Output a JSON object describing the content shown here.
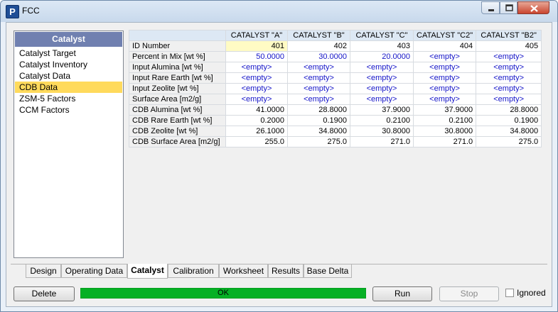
{
  "window": {
    "title": "FCC",
    "app_icon_letter": "P"
  },
  "sidebar": {
    "header": "Catalyst",
    "items": [
      {
        "label": "Catalyst Target",
        "selected": false
      },
      {
        "label": "Catalyst Inventory",
        "selected": false
      },
      {
        "label": "Catalyst Data",
        "selected": false
      },
      {
        "label": "CDB Data",
        "selected": true
      },
      {
        "label": "ZSM-5 Factors",
        "selected": false
      },
      {
        "label": "CCM Factors",
        "selected": false
      }
    ]
  },
  "grid": {
    "columns": [
      "CATALYST \"A\"",
      "CATALYST \"B\"",
      "CATALYST \"C\"",
      "CATALYST \"C2\"",
      "CATALYST \"B2\""
    ],
    "rows": [
      {
        "label": "ID Number",
        "style": "black",
        "values": [
          "401",
          "402",
          "403",
          "404",
          "405"
        ]
      },
      {
        "label": "Percent in Mix [wt %]",
        "style": "blue",
        "values": [
          "50.0000",
          "30.0000",
          "20.0000",
          "<empty>",
          "<empty>"
        ]
      },
      {
        "label": "Input Alumina [wt %]",
        "style": "blue",
        "values": [
          "<empty>",
          "<empty>",
          "<empty>",
          "<empty>",
          "<empty>"
        ]
      },
      {
        "label": "Input Rare Earth [wt %]",
        "style": "blue",
        "values": [
          "<empty>",
          "<empty>",
          "<empty>",
          "<empty>",
          "<empty>"
        ]
      },
      {
        "label": "Input Zeolite [wt %]",
        "style": "blue",
        "values": [
          "<empty>",
          "<empty>",
          "<empty>",
          "<empty>",
          "<empty>"
        ]
      },
      {
        "label": "Surface Area [m2/g]",
        "style": "blue",
        "values": [
          "<empty>",
          "<empty>",
          "<empty>",
          "<empty>",
          "<empty>"
        ]
      },
      {
        "label": "CDB Alumina [wt %]",
        "style": "black",
        "values": [
          "41.0000",
          "28.8000",
          "37.9000",
          "37.9000",
          "28.8000"
        ]
      },
      {
        "label": "CDB Rare Earth [wt %]",
        "style": "black",
        "values": [
          "0.2000",
          "0.1900",
          "0.2100",
          "0.2100",
          "0.1900"
        ]
      },
      {
        "label": "CDB Zeolite [wt %]",
        "style": "black",
        "values": [
          "26.1000",
          "34.8000",
          "30.8000",
          "30.8000",
          "34.8000"
        ]
      },
      {
        "label": "CDB Surface Area [m2/g]",
        "style": "black",
        "values": [
          "255.0",
          "275.0",
          "271.0",
          "271.0",
          "275.0"
        ]
      }
    ]
  },
  "tabs": [
    {
      "label": "Design",
      "active": false
    },
    {
      "label": "Operating Data",
      "active": false
    },
    {
      "label": "Catalyst",
      "active": true
    },
    {
      "label": "Calibration",
      "active": false
    },
    {
      "label": "Worksheet",
      "active": false
    },
    {
      "label": "Results",
      "active": false
    },
    {
      "label": "Base Delta",
      "active": false
    }
  ],
  "buttons": {
    "delete": "Delete",
    "run": "Run",
    "stop": "Stop"
  },
  "status": {
    "text": "OK",
    "color": "#06b025"
  },
  "ignored": {
    "label": "Ignored",
    "checked": false
  },
  "colors": {
    "selected_item": "#ffda5c",
    "sidebar_header": "#7080b0",
    "input_value": "#1414c8"
  }
}
